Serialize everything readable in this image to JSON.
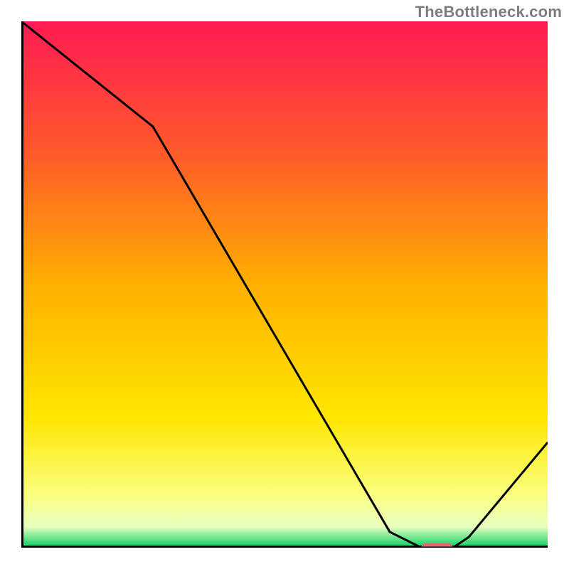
{
  "watermark": "TheBottleneck.com",
  "chart_data": {
    "type": "line",
    "title": "",
    "xlabel": "",
    "ylabel": "",
    "xlim": [
      0,
      100
    ],
    "ylim": [
      0,
      100
    ],
    "x": [
      0,
      25,
      70,
      76,
      82,
      85,
      100
    ],
    "values": [
      100,
      80,
      3,
      0,
      0,
      2,
      20
    ],
    "marker": {
      "x_start": 76,
      "x_end": 82,
      "y": 0
    },
    "gradient_stops": [
      {
        "pos": 0.0,
        "color": "#ff1a54"
      },
      {
        "pos": 0.25,
        "color": "#ff5a2a"
      },
      {
        "pos": 0.5,
        "color": "#ffb000"
      },
      {
        "pos": 0.75,
        "color": "#ffe600"
      },
      {
        "pos": 0.9,
        "color": "#fbff80"
      },
      {
        "pos": 0.96,
        "color": "#e9ffc0"
      },
      {
        "pos": 1.0,
        "color": "#00d060"
      }
    ],
    "axis_color": "#000000",
    "line_color": "#000000",
    "marker_color": "#e06a6a"
  }
}
